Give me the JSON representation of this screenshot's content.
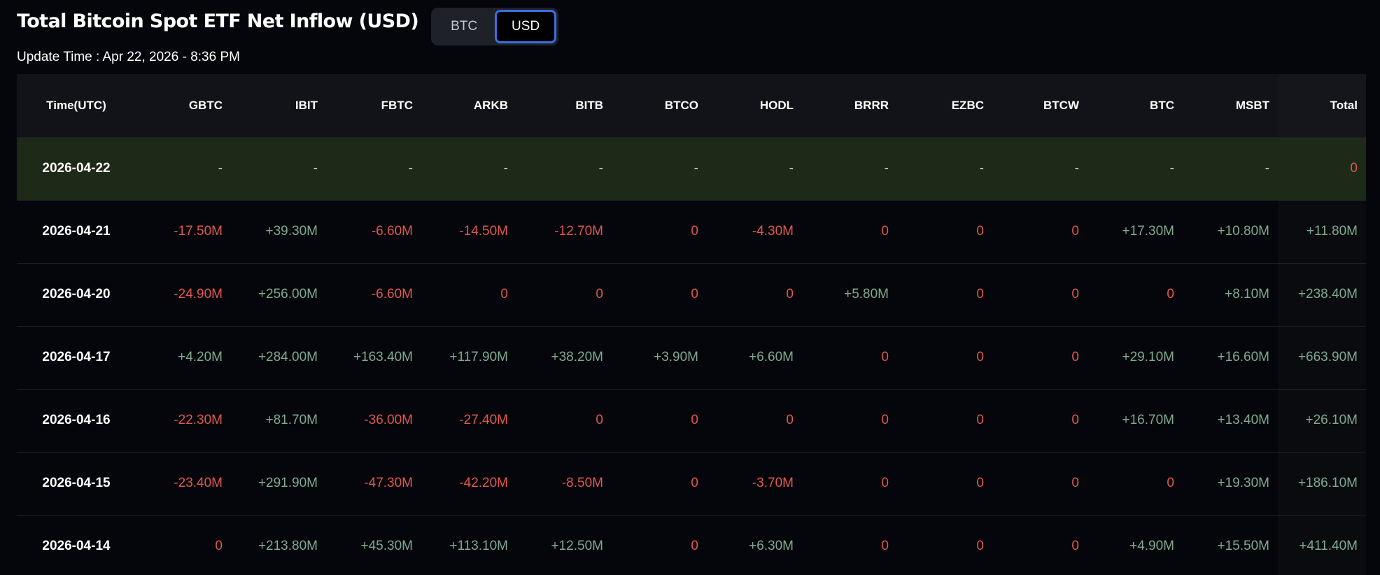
{
  "header": {
    "title": "Total Bitcoin Spot ETF Net Inflow (USD)",
    "toggle": [
      {
        "label": "BTC",
        "active": false
      },
      {
        "label": "USD",
        "active": true
      }
    ],
    "update_time": "Update Time : Apr 22, 2026 - 8:36 PM"
  },
  "colors": {
    "positive": "#7fa98f",
    "negative": "#e0574d",
    "neutral": "#d4d6da",
    "highlight_row": "#1d2a17",
    "accent": "#3a6fe0"
  },
  "table": {
    "columns": [
      "Time(UTC)",
      "GBTC",
      "IBIT",
      "FBTC",
      "ARKB",
      "BITB",
      "BTCO",
      "HODL",
      "BRRR",
      "EZBC",
      "BTCW",
      "BTC",
      "MSBT",
      "Total"
    ],
    "rows": [
      {
        "highlight": true,
        "cells": [
          "2026-04-22",
          "-",
          "-",
          "-",
          "-",
          "-",
          "-",
          "-",
          "-",
          "-",
          "-",
          "-",
          "-",
          "0"
        ]
      },
      {
        "highlight": false,
        "cells": [
          "2026-04-21",
          "-17.50M",
          "+39.30M",
          "-6.60M",
          "-14.50M",
          "-12.70M",
          "0",
          "-4.30M",
          "0",
          "0",
          "0",
          "+17.30M",
          "+10.80M",
          "+11.80M"
        ]
      },
      {
        "highlight": false,
        "cells": [
          "2026-04-20",
          "-24.90M",
          "+256.00M",
          "-6.60M",
          "0",
          "0",
          "0",
          "0",
          "+5.80M",
          "0",
          "0",
          "0",
          "+8.10M",
          "+238.40M"
        ]
      },
      {
        "highlight": false,
        "cells": [
          "2026-04-17",
          "+4.20M",
          "+284.00M",
          "+163.40M",
          "+117.90M",
          "+38.20M",
          "+3.90M",
          "+6.60M",
          "0",
          "0",
          "0",
          "+29.10M",
          "+16.60M",
          "+663.90M"
        ]
      },
      {
        "highlight": false,
        "cells": [
          "2026-04-16",
          "-22.30M",
          "+81.70M",
          "-36.00M",
          "-27.40M",
          "0",
          "0",
          "0",
          "0",
          "0",
          "0",
          "+16.70M",
          "+13.40M",
          "+26.10M"
        ]
      },
      {
        "highlight": false,
        "cells": [
          "2026-04-15",
          "-23.40M",
          "+291.90M",
          "-47.30M",
          "-42.20M",
          "-8.50M",
          "0",
          "-3.70M",
          "0",
          "0",
          "0",
          "0",
          "+19.30M",
          "+186.10M"
        ]
      },
      {
        "highlight": false,
        "cells": [
          "2026-04-14",
          "0",
          "+213.80M",
          "+45.30M",
          "+113.10M",
          "+12.50M",
          "0",
          "+6.30M",
          "0",
          "0",
          "0",
          "+4.90M",
          "+15.50M",
          "+411.40M"
        ]
      }
    ]
  }
}
